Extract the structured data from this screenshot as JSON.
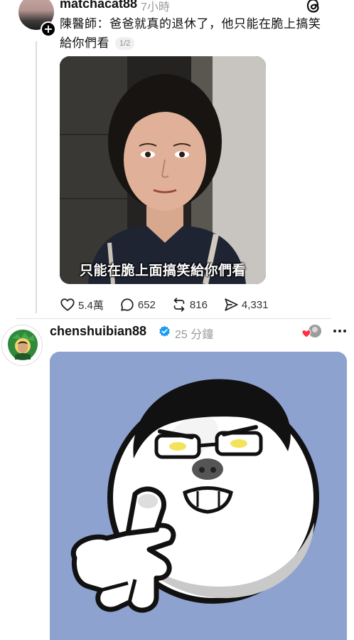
{
  "post1": {
    "username": "matchacat88",
    "time": "7小時",
    "caption": "陳醫師：爸爸就真的退休了，他只能在脆上搞笑給你們看",
    "media_counter": "1/2",
    "video_subtitle": "只能在脆上面搞笑給你們看",
    "stats": {
      "likes": "5.4萬",
      "comments": "652",
      "reposts": "816",
      "shares": "4,331"
    }
  },
  "post2": {
    "username": "chenshuibian88",
    "time": "25 分鐘"
  },
  "colors": {
    "verified": "#1d9bf0",
    "like_heart": "#ff3040",
    "sticker_bg": "#8ea2cf"
  },
  "icons": [
    "add-follow-icon",
    "threads-logo-icon",
    "heart-icon",
    "comment-icon",
    "repost-icon",
    "share-icon",
    "verified-badge-icon",
    "liked-heart-icon",
    "more-icon"
  ]
}
